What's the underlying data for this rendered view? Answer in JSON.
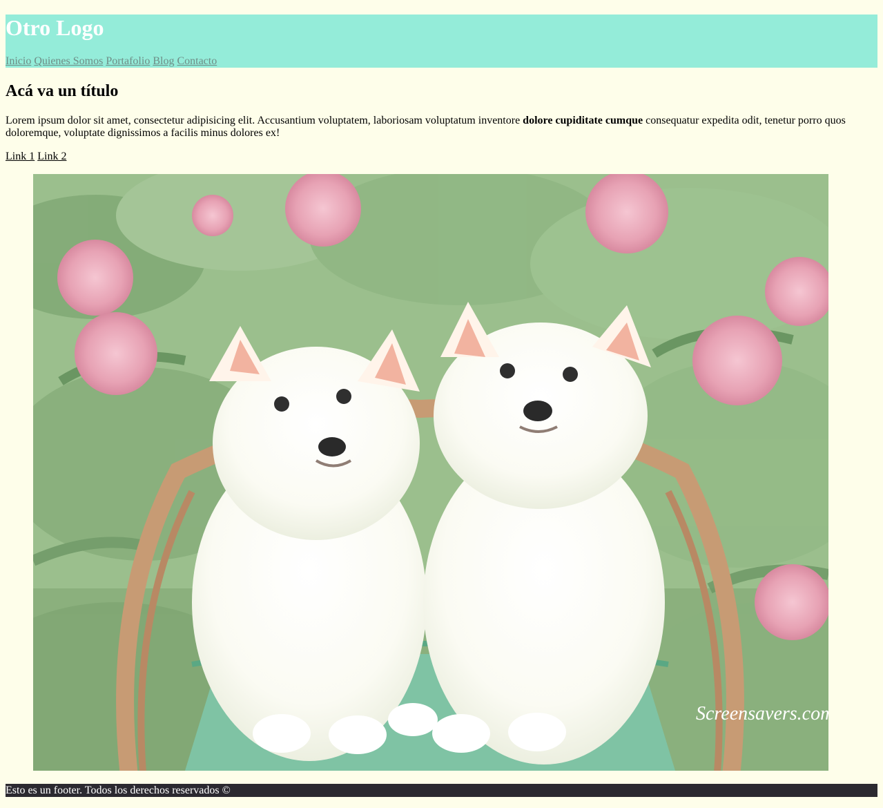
{
  "header": {
    "logo": "Otro Logo",
    "nav": [
      "Inicio",
      "Quienes Somos",
      "Portafolio",
      "Blog",
      "Contacto"
    ],
    "background_color": "#94ecd9",
    "logo_color": "#ffffff",
    "nav_link_color": "#6e8d86"
  },
  "main": {
    "title": "Acá va un título",
    "paragraph": {
      "before": "Lorem ipsum dolor sit amet, consectetur adipisicing elit. Accusantium voluptatem, laboriosam voluptatum inventore ",
      "bold": "dolore cupiditate cumque",
      "after": " consequatur expedita odit, tenetur porro quos doloremque, voluptate dignissimos a facilis minus dolores ex!"
    },
    "links": [
      "Link 1",
      "Link 2"
    ],
    "image": {
      "description_icon": "puppies-photo",
      "watermark": "Screensavers.com"
    }
  },
  "footer": {
    "text": "Esto es un footer. Todos los derechos reservados ©",
    "background_color": "#2b2930",
    "text_color": "#ffffff"
  },
  "page": {
    "background_color": "#fefeea"
  }
}
